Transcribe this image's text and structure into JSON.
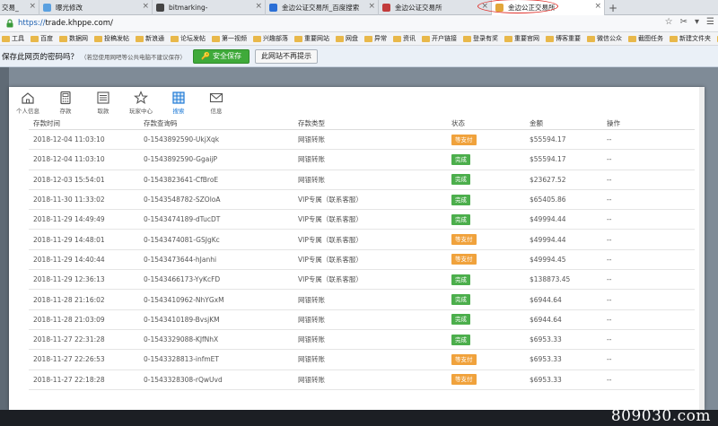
{
  "browser": {
    "tabs": [
      {
        "label": "交易_",
        "color": "#888888"
      },
      {
        "label": "曝光修改",
        "color": "#5aa0e0"
      },
      {
        "label": "bitmarking-",
        "color": "#444444"
      },
      {
        "label": "金边公证交易所_百度搜索",
        "color": "#2b6fd6"
      },
      {
        "label": "金边公证交易所",
        "color": "#c23b3b"
      },
      {
        "label": "金边公正交易所",
        "color": "#e2a63a",
        "active": true
      }
    ],
    "new_tab": "+",
    "tab_close": "×",
    "url_scheme": "https://",
    "url_host": "trade.khppe.com/",
    "addr_actions": [
      "☆",
      "✂",
      "▾",
      "☰"
    ],
    "bookmarks": [
      "工具",
      "百度",
      "数据网",
      "投稿发帖",
      "新浪通",
      "论坛发帖",
      "第一视频",
      "兴趣部落",
      "重要网站",
      "网盘",
      "异常",
      "资讯",
      "开户链接",
      "登录有奖",
      "重要官网",
      "博客重要",
      "微信公众",
      "截图任务",
      "新建文件夹",
      "孙燕"
    ],
    "password_prompt": {
      "question": "保存此网页的密码吗？",
      "note": "（若您使用网吧等公共电脑不建议保存）",
      "save": "安全保存",
      "never": "此网站不再提示"
    }
  },
  "nav": [
    {
      "label": "个人信息",
      "icon": "home-icon"
    },
    {
      "label": "存款",
      "icon": "calculator-icon"
    },
    {
      "label": "取款",
      "icon": "list-icon"
    },
    {
      "label": "玩家中心",
      "icon": "star-icon"
    },
    {
      "label": "搜索",
      "icon": "table-icon",
      "active": true
    },
    {
      "label": "信息",
      "icon": "mail-icon"
    }
  ],
  "table": {
    "headers": [
      "存款时间",
      "存款查询码",
      "存款类型",
      "状态",
      "金额",
      "操作"
    ],
    "rows": [
      {
        "time": "2018-12-04 11:03:10",
        "code": "0-1543892590-UkjXqk",
        "type": "网银转账",
        "status": "等支付",
        "amount": "$55594.17",
        "op": "--"
      },
      {
        "time": "2018-12-04 11:03:10",
        "code": "0-1543892590-GgaijP",
        "type": "网银转账",
        "status": "完成",
        "amount": "$55594.17",
        "op": "--"
      },
      {
        "time": "2018-12-03 15:54:01",
        "code": "0-1543823641-CfBroE",
        "type": "网银转账",
        "status": "完成",
        "amount": "$23627.52",
        "op": "--"
      },
      {
        "time": "2018-11-30 11:33:02",
        "code": "0-1543548782-SZOloA",
        "type": "VIP专属（联系客服）",
        "status": "完成",
        "amount": "$65405.86",
        "op": "--"
      },
      {
        "time": "2018-11-29 14:49:49",
        "code": "0-1543474189-dTucDT",
        "type": "VIP专属（联系客服）",
        "status": "完成",
        "amount": "$49994.44",
        "op": "--"
      },
      {
        "time": "2018-11-29 14:48:01",
        "code": "0-1543474081-GSJgKc",
        "type": "VIP专属（联系客服）",
        "status": "等支付",
        "amount": "$49994.44",
        "op": "--"
      },
      {
        "time": "2018-11-29 14:40:44",
        "code": "0-1543473644-hJanhi",
        "type": "VIP专属（联系客服）",
        "status": "等支付",
        "amount": "$49994.45",
        "op": "--"
      },
      {
        "time": "2018-11-29 12:36:13",
        "code": "0-1543466173-YyKcFD",
        "type": "VIP专属（联系客服）",
        "status": "完成",
        "amount": "$138873.45",
        "op": "--"
      },
      {
        "time": "2018-11-28 21:16:02",
        "code": "0-1543410962-NhYGxM",
        "type": "网银转账",
        "status": "完成",
        "amount": "$6944.64",
        "op": "--"
      },
      {
        "time": "2018-11-28 21:03:09",
        "code": "0-1543410189-BvsjKM",
        "type": "网银转账",
        "status": "完成",
        "amount": "$6944.64",
        "op": "--"
      },
      {
        "time": "2018-11-27 22:31:28",
        "code": "0-1543329088-KJfNhX",
        "type": "网银转账",
        "status": "完成",
        "amount": "$6953.33",
        "op": "--"
      },
      {
        "time": "2018-11-27 22:26:53",
        "code": "0-1543328813-infmET",
        "type": "网银转账",
        "status": "等支付",
        "amount": "$6953.33",
        "op": "--"
      },
      {
        "time": "2018-11-27 22:18:28",
        "code": "0-1543328308-rQwUvd",
        "type": "网银转账",
        "status": "等支付",
        "amount": "$6953.33",
        "op": "--"
      }
    ]
  },
  "colors": {
    "done": "#4cae4c",
    "pending": "#f0a23c",
    "accent": "#1e7ad6"
  },
  "watermark": "809030.com"
}
